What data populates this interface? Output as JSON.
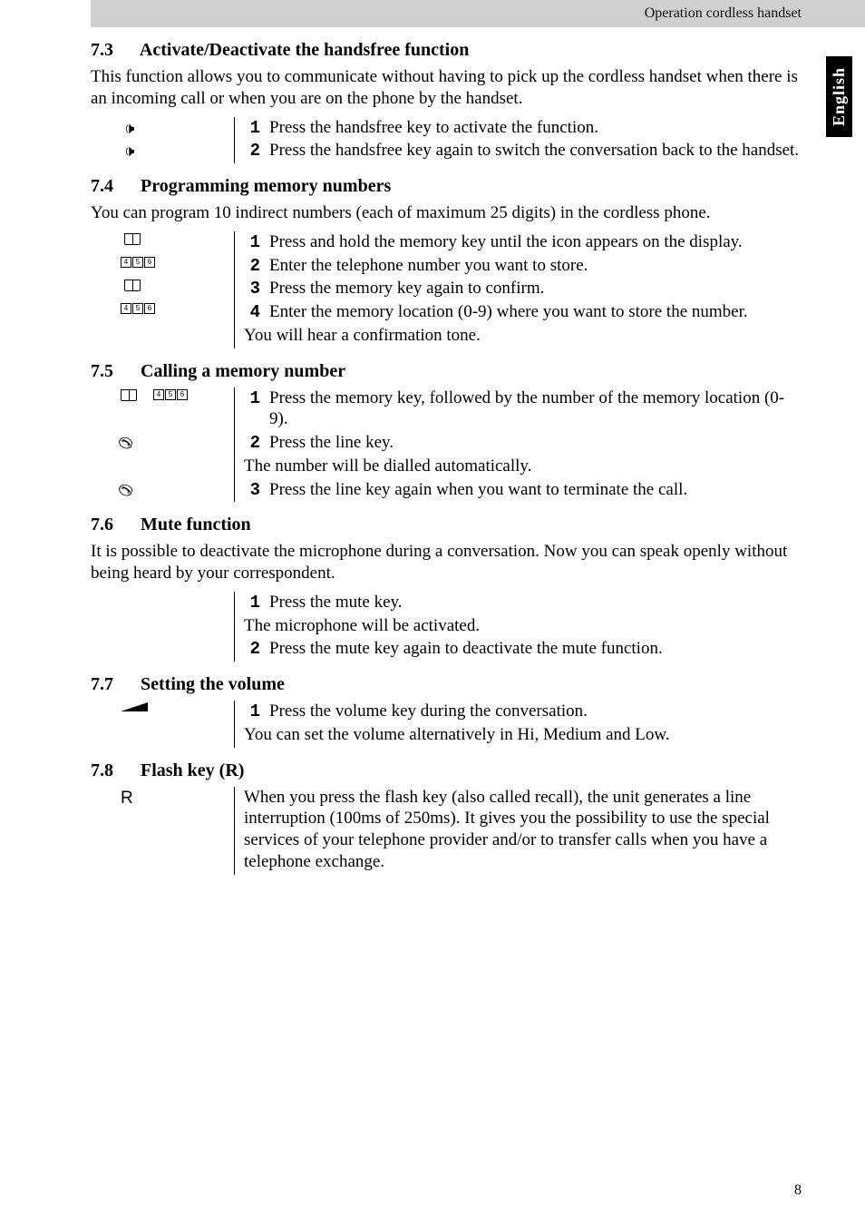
{
  "header": {
    "chapter_title": "Operation cordless handset"
  },
  "lang_tab": "English",
  "page_number": "8",
  "sections": {
    "s73": {
      "num": "7.3",
      "title": "Activate/Deactivate the handsfree function",
      "intro": "This function allows you to communicate without having to pick up the cordless handset when there is an incoming call or when you are on the phone by the handset.",
      "steps": [
        {
          "n": "1",
          "text": "Press the handsfree key to activate the function.",
          "icons": [
            "speaker"
          ]
        },
        {
          "n": "2",
          "text": "Press the handsfree key again to switch the conversation back to the handset.",
          "icons": [
            "speaker"
          ],
          "justify": true
        }
      ]
    },
    "s74": {
      "num": "7.4",
      "title": "Programming memory numbers",
      "intro": "You can program 10 indirect numbers (each of maximum 25 digits) in the cordless phone.",
      "steps": [
        {
          "n": "1",
          "text": "Press and hold the memory key until the icon appears on the display.",
          "icons": [
            "book"
          ]
        },
        {
          "n": "2",
          "text": "Enter the telephone number you want to store.",
          "icons": [
            "keys"
          ]
        },
        {
          "n": "3",
          "text": "Press the memory key again to confirm.",
          "icons": [
            "book"
          ]
        },
        {
          "n": "4",
          "text": "Enter the memory location (0-9) where you want to store the number.",
          "icons": [
            "keys"
          ]
        }
      ],
      "note": "You will hear a confirmation tone."
    },
    "s75": {
      "num": "7.5",
      "title": "Calling a memory number",
      "steps": [
        {
          "n": "1",
          "text": "Press the memory key, followed by the number of the memory location (0-9).",
          "icons": [
            "book",
            "keys"
          ]
        },
        {
          "n": "2",
          "text": "Press the line key.",
          "icons": [
            "line"
          ]
        }
      ],
      "note1": "The number will be dialled automatically.",
      "step3": {
        "n": "3",
        "text": "Press the line key again when you want to terminate the call.",
        "icons": [
          "line"
        ]
      }
    },
    "s76": {
      "num": "7.6",
      "title": "Mute function",
      "intro": "It is possible to deactivate the microphone during a conversation. Now you can speak openly without being heard by your correspondent.",
      "steps": [
        {
          "n": "1",
          "text": "Press the mute key.",
          "icons": [
            "mute"
          ]
        }
      ],
      "note": "The microphone will be activated.",
      "step2": {
        "n": "2",
        "text": "Press the mute key again to deactivate the mute function.",
        "icons": [
          "mute"
        ]
      }
    },
    "s77": {
      "num": "7.7",
      "title": "Setting the volume",
      "steps": [
        {
          "n": "1",
          "text": "Press the volume key during the conversation.",
          "icons": [
            "volume"
          ]
        }
      ],
      "note": "You can set the volume alternatively in Hi, Medium and Low."
    },
    "s78": {
      "num": "7.8",
      "title": "Flash key (R)",
      "body": "When you press the flash key (also called recall), the unit generates a line interruption (100ms of 250ms). It gives you the possibility to use the special services of your telephone provider and/or to transfer calls when you have a telephone exchange.",
      "icon": "R"
    }
  }
}
